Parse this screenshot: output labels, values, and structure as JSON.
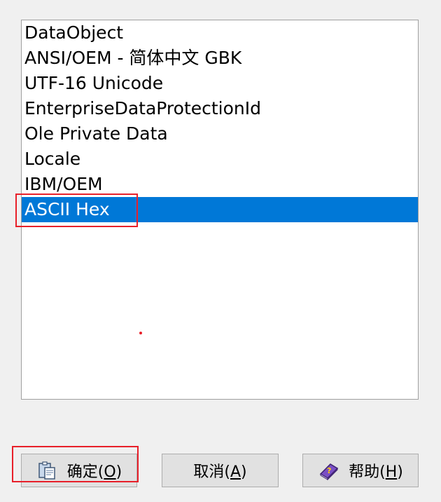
{
  "list": {
    "items": [
      {
        "label": "DataObject",
        "selected": false
      },
      {
        "label": "ANSI/OEM - 简体中文 GBK",
        "selected": false
      },
      {
        "label": "UTF-16 Unicode",
        "selected": false
      },
      {
        "label": "EnterpriseDataProtectionId",
        "selected": false
      },
      {
        "label": "Ole Private Data",
        "selected": false
      },
      {
        "label": "Locale",
        "selected": false
      },
      {
        "label": "IBM/OEM",
        "selected": false
      },
      {
        "label": "ASCII Hex",
        "selected": true
      }
    ],
    "selected_color": "#0078d7"
  },
  "buttons": {
    "ok": {
      "text": "确定(",
      "mnemonic": "O",
      "suffix": ")",
      "icon": "clipboard-paste-icon"
    },
    "cancel": {
      "text": "取消(",
      "mnemonic": "A",
      "suffix": ")"
    },
    "help": {
      "text": "帮助(",
      "mnemonic": "H",
      "suffix": ")",
      "icon": "help-book-icon"
    }
  },
  "annotation_color": "#e8202a"
}
